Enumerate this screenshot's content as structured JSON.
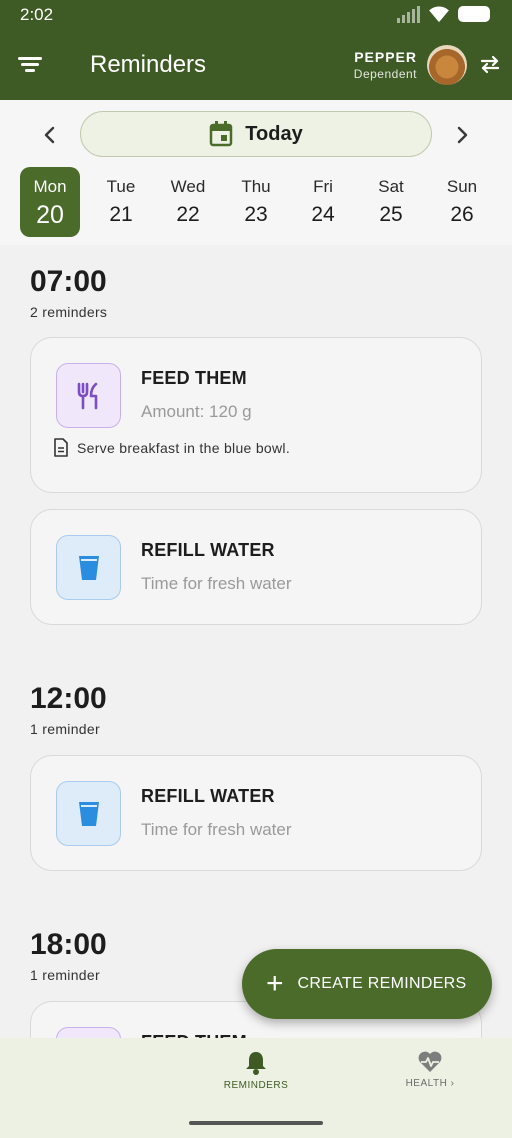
{
  "status_bar": {
    "time": "2:02"
  },
  "app_bar": {
    "title": "Reminders",
    "pet_name": "PEPPER",
    "pet_role": "Dependent"
  },
  "date_nav": {
    "current_label": "Today",
    "days": [
      {
        "dow": "Mon",
        "num": "20",
        "selected": true
      },
      {
        "dow": "Tue",
        "num": "21"
      },
      {
        "dow": "Wed",
        "num": "22"
      },
      {
        "dow": "Thu",
        "num": "23"
      },
      {
        "dow": "Fri",
        "num": "24"
      },
      {
        "dow": "Sat",
        "num": "25"
      },
      {
        "dow": "Sun",
        "num": "26"
      }
    ]
  },
  "slots": [
    {
      "time": "07:00",
      "count": "2 reminders",
      "cards": [
        {
          "icon": "fork-knife-icon",
          "title": "FEED THEM",
          "subtitle": "Amount: 120 g",
          "note": "Serve breakfast in the blue bowl."
        },
        {
          "icon": "water-glass-icon",
          "title": "REFILL WATER",
          "subtitle": "Time for fresh water"
        }
      ]
    },
    {
      "time": "12:00",
      "count": "1 reminder",
      "cards": [
        {
          "icon": "water-glass-icon",
          "title": "REFILL WATER",
          "subtitle": "Time for fresh water"
        }
      ]
    },
    {
      "time": "18:00",
      "count": "1 reminder",
      "cards": [
        {
          "icon": "fork-knife-icon",
          "title": "FEED THEM"
        }
      ]
    }
  ],
  "fab": {
    "label": "CREATE REMINDERS"
  },
  "bottom_nav": {
    "items": [
      {
        "label": "REMINDERS",
        "icon": "bell-icon",
        "active": true
      },
      {
        "label": "HEALTH",
        "icon": "heart-pulse-icon"
      }
    ]
  },
  "colors": {
    "primary": "#3f5b25",
    "accent": "#4a6b2a",
    "food": "#7b4fc3",
    "water": "#2a8de0"
  }
}
